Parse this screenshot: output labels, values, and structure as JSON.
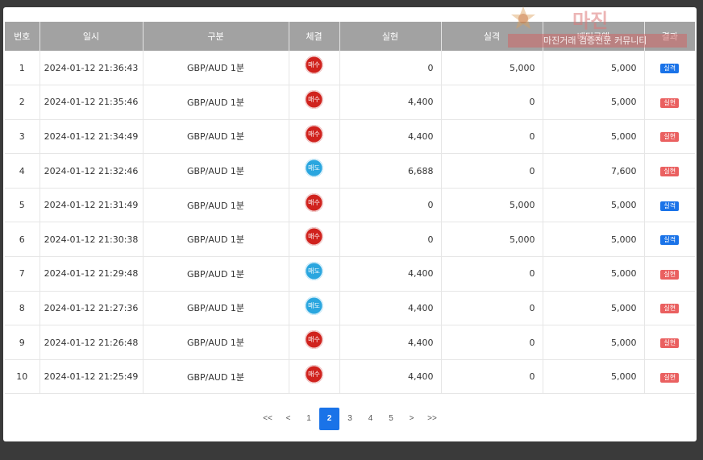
{
  "table": {
    "headers": [
      "번호",
      "일시",
      "구분",
      "체결",
      "실현",
      "실격",
      "배팅금액",
      "결과"
    ],
    "rows": [
      {
        "no": "1",
        "datetime": "2024-01-12 21:36:43",
        "type": "GBP/AUD 1분",
        "trade": "매수",
        "trade_kind": "buy",
        "realized": "0",
        "failed": "5,000",
        "bet": "5,000",
        "result": "실격",
        "result_kind": "fail"
      },
      {
        "no": "2",
        "datetime": "2024-01-12 21:35:46",
        "type": "GBP/AUD 1분",
        "trade": "매수",
        "trade_kind": "buy",
        "realized": "4,400",
        "failed": "0",
        "bet": "5,000",
        "result": "실현",
        "result_kind": "hit"
      },
      {
        "no": "3",
        "datetime": "2024-01-12 21:34:49",
        "type": "GBP/AUD 1분",
        "trade": "매수",
        "trade_kind": "buy",
        "realized": "4,400",
        "failed": "0",
        "bet": "5,000",
        "result": "실현",
        "result_kind": "hit"
      },
      {
        "no": "4",
        "datetime": "2024-01-12 21:32:46",
        "type": "GBP/AUD 1분",
        "trade": "매도",
        "trade_kind": "sell",
        "realized": "6,688",
        "failed": "0",
        "bet": "7,600",
        "result": "실현",
        "result_kind": "hit"
      },
      {
        "no": "5",
        "datetime": "2024-01-12 21:31:49",
        "type": "GBP/AUD 1분",
        "trade": "매수",
        "trade_kind": "buy",
        "realized": "0",
        "failed": "5,000",
        "bet": "5,000",
        "result": "실격",
        "result_kind": "fail"
      },
      {
        "no": "6",
        "datetime": "2024-01-12 21:30:38",
        "type": "GBP/AUD 1분",
        "trade": "매수",
        "trade_kind": "buy",
        "realized": "0",
        "failed": "5,000",
        "bet": "5,000",
        "result": "실격",
        "result_kind": "fail"
      },
      {
        "no": "7",
        "datetime": "2024-01-12 21:29:48",
        "type": "GBP/AUD 1분",
        "trade": "매도",
        "trade_kind": "sell",
        "realized": "4,400",
        "failed": "0",
        "bet": "5,000",
        "result": "실현",
        "result_kind": "hit"
      },
      {
        "no": "8",
        "datetime": "2024-01-12 21:27:36",
        "type": "GBP/AUD 1분",
        "trade": "매도",
        "trade_kind": "sell",
        "realized": "4,400",
        "failed": "0",
        "bet": "5,000",
        "result": "실현",
        "result_kind": "hit"
      },
      {
        "no": "9",
        "datetime": "2024-01-12 21:26:48",
        "type": "GBP/AUD 1분",
        "trade": "매수",
        "trade_kind": "buy",
        "realized": "4,400",
        "failed": "0",
        "bet": "5,000",
        "result": "실현",
        "result_kind": "hit"
      },
      {
        "no": "10",
        "datetime": "2024-01-12 21:25:49",
        "type": "GBP/AUD 1분",
        "trade": "매수",
        "trade_kind": "buy",
        "realized": "4,400",
        "failed": "0",
        "bet": "5,000",
        "result": "실현",
        "result_kind": "hit"
      }
    ]
  },
  "pagination": {
    "items": [
      "<<",
      "<",
      "1",
      "2",
      "3",
      "4",
      "5",
      ">",
      ">>"
    ],
    "current": "2"
  },
  "watermark": {
    "title": "마진",
    "subtitle": "마진거래 검증전문 커뮤니티",
    "icon": "police-badge-icon"
  },
  "colors": {
    "buy": "#d0221d",
    "sell": "#2aa6df",
    "fail": "#1a73e8",
    "hit": "#ea6060",
    "active_page": "#1a73e8",
    "header_bg": "#a2a2a2"
  }
}
